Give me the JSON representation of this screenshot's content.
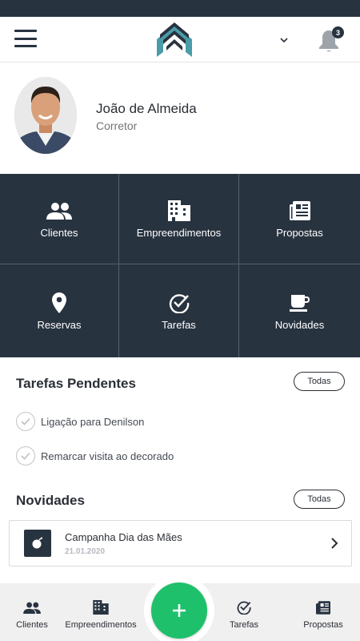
{
  "header": {
    "notification_count": "3",
    "colors": {
      "dark": "#283340",
      "accent": "#4a9ca8",
      "fab": "#1fc06b"
    }
  },
  "profile": {
    "name": "João de Almeida",
    "role": "Corretor"
  },
  "tiles": [
    {
      "label": "Clientes",
      "icon": "people-icon"
    },
    {
      "label": "Empreendimentos",
      "icon": "building-icon"
    },
    {
      "label": "Propostas",
      "icon": "newspaper-icon"
    },
    {
      "label": "Reservas",
      "icon": "location-pin-icon"
    },
    {
      "label": "Tarefas",
      "icon": "check-circle-icon"
    },
    {
      "label": "Novidades",
      "icon": "coffee-icon"
    }
  ],
  "tasks_section": {
    "title": "Tarefas Pendentes",
    "all_label": "Todas",
    "items": [
      {
        "text": "Ligação para Denilson"
      },
      {
        "text": "Remarcar visita ao decorado"
      }
    ]
  },
  "news_section": {
    "title": "Novidades",
    "all_label": "Todas",
    "items": [
      {
        "title": "Campanha Dia das Mães",
        "date": "21.01.2020",
        "icon": "bomb-icon"
      }
    ]
  },
  "bottom_nav": {
    "items": [
      {
        "label": "Clientes",
        "icon": "people-icon"
      },
      {
        "label": "Empreendimentos",
        "icon": "building-icon"
      },
      {
        "label": "Tarefas",
        "icon": "check-circle-icon"
      },
      {
        "label": "Propostas",
        "icon": "newspaper-icon"
      }
    ],
    "fab_icon": "plus-icon"
  }
}
